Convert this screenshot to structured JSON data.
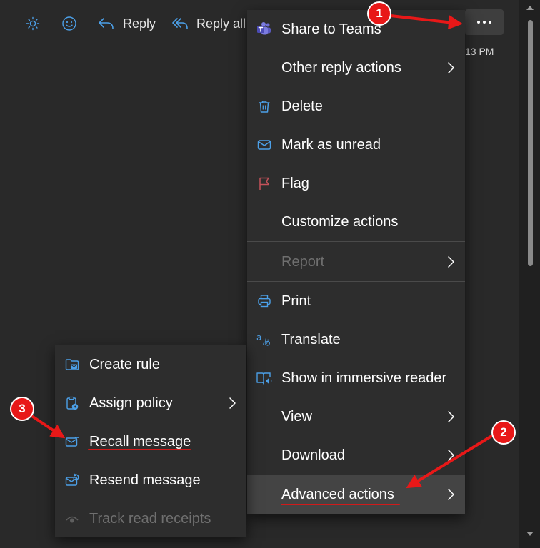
{
  "toolbar": {
    "reply_label": "Reply",
    "reply_all_label": "Reply all"
  },
  "message": {
    "time_fragment": "13 PM"
  },
  "main_menu": {
    "share_teams": "Share to Teams",
    "other_reply": "Other reply actions",
    "delete": "Delete",
    "mark_unread": "Mark as unread",
    "flag": "Flag",
    "customize": "Customize actions",
    "report": "Report",
    "print": "Print",
    "translate": "Translate",
    "immersive": "Show in immersive reader",
    "view": "View",
    "download": "Download",
    "advanced": "Advanced actions"
  },
  "sub_menu": {
    "create_rule": "Create rule",
    "assign_policy": "Assign policy",
    "recall": "Recall message",
    "resend": "Resend message",
    "track": "Track read receipts"
  },
  "annotations": {
    "step1": "1",
    "step2": "2",
    "step3": "3"
  },
  "colors": {
    "accent": "#4ca0e8",
    "flag": "#c4525a",
    "teams": "#6f6fd6",
    "annotation": "#e81818"
  }
}
